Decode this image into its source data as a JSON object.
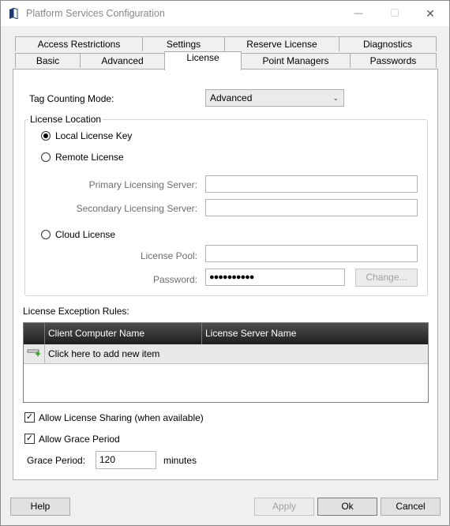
{
  "window": {
    "title": "Platform Services Configuration",
    "minimize_glyph": "—",
    "maximize_glyph": "☐",
    "close_glyph": "✕"
  },
  "tabs": {
    "row_top": [
      "Access Restrictions",
      "Settings",
      "Reserve License",
      "Diagnostics"
    ],
    "row_bottom": [
      "Basic",
      "Advanced",
      "License",
      "Point Managers",
      "Passwords"
    ],
    "active": "License"
  },
  "license": {
    "tag_counting_mode_label": "Tag Counting Mode:",
    "tag_counting_mode_value": "Advanced",
    "location_group_label": "License Location",
    "local_key_label": "Local License Key",
    "remote_label": "Remote License",
    "primary_server_label": "Primary Licensing Server:",
    "primary_server_value": "",
    "secondary_server_label": "Secondary Licensing Server:",
    "secondary_server_value": "",
    "cloud_label": "Cloud License",
    "pool_label": "License Pool:",
    "pool_value": "",
    "password_label": "Password:",
    "password_value": "●●●●●●●●●●",
    "change_button": "Change...",
    "selected_location": "local"
  },
  "exceptions": {
    "label": "License Exception Rules:",
    "columns": [
      "Client Computer Name",
      "License Server Name"
    ],
    "new_item_text": "Click here to add new item",
    "rows": []
  },
  "options": {
    "allow_sharing_label": "Allow License Sharing (when available)",
    "allow_sharing_checked": true,
    "allow_grace_label": "Allow Grace Period",
    "allow_grace_checked": true,
    "grace_period_label": "Grace Period:",
    "grace_period_value": "120",
    "grace_period_unit": "minutes"
  },
  "footer": {
    "help": "Help",
    "apply": "Apply",
    "ok": "Ok",
    "cancel": "Cancel"
  },
  "icons": {
    "app": "book-icon",
    "new_row": "add-row-icon",
    "dropdown": "chevron-down-icon"
  }
}
